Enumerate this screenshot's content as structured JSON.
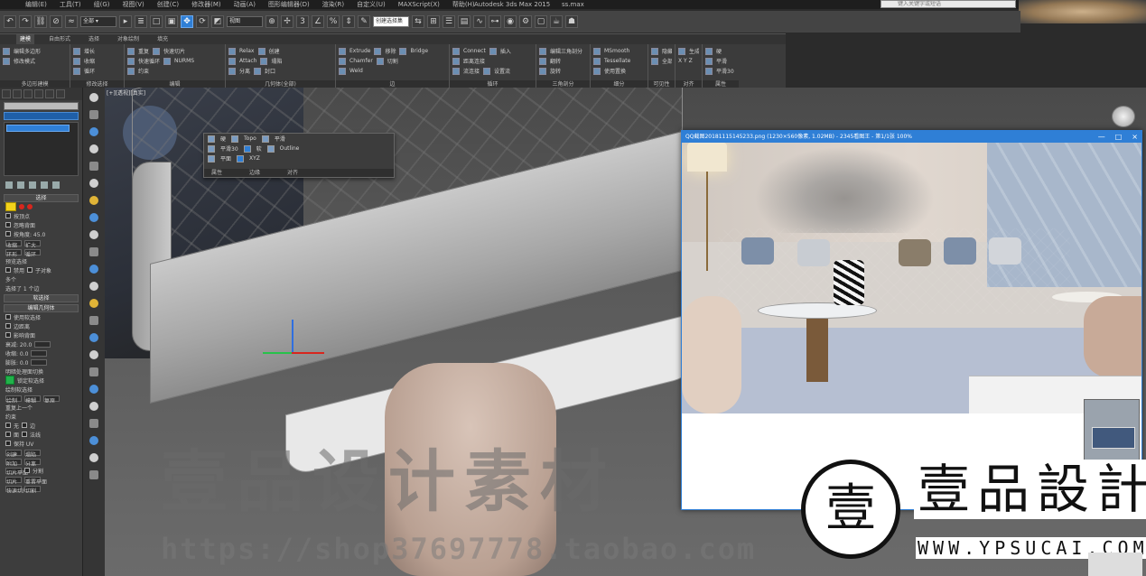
{
  "window": {
    "app_title": "Autodesk 3ds Max 2015",
    "file_title": "ss.max",
    "search_placeholder": "键入关键字或短语"
  },
  "menu": {
    "items": [
      "编辑(E)",
      "工具(T)",
      "组(G)",
      "视图(V)",
      "创建(C)",
      "修改器(M)",
      "动画(A)",
      "图形编辑器(D)",
      "渲染(R)",
      "自定义(U)",
      "MAXScript(X)",
      "帮助(H)"
    ]
  },
  "toolbar": {
    "view_select": "视图",
    "selection_set": "创建选择集"
  },
  "ribbon": {
    "tabs": [
      "建模",
      "自由形式",
      "选择",
      "对象绘制",
      "填充"
    ],
    "groups": [
      {
        "label": "多边形建模",
        "rows": [
          "编辑多边形",
          "修改模式"
        ]
      },
      {
        "label": "修改选择",
        "rows": [
          "增长",
          "收缩",
          "循环",
          "环形"
        ]
      },
      {
        "label": "编辑",
        "rows": [
          "重复",
          "快速切片",
          "快速循环",
          "NURMS",
          "约束"
        ]
      },
      {
        "label": "几何体(全部)",
        "rows": [
          "Relax",
          "创建",
          "Attach",
          "塌陷",
          "分离",
          "封口"
        ]
      },
      {
        "label": "边",
        "rows": [
          "Extrude",
          "移除",
          "Bridge",
          "Chamfer",
          "切割",
          "Weld"
        ]
      },
      {
        "label": "循环",
        "rows": [
          "Connect",
          "插入",
          "距离连接",
          "流连接",
          "设置流"
        ]
      },
      {
        "label": "三角剖分",
        "rows": [
          "编辑三角剖分",
          "翻转",
          "旋转"
        ]
      },
      {
        "label": "细分",
        "rows": [
          "MSmooth",
          "Tessellate",
          "使用置换"
        ]
      },
      {
        "label": "可见性",
        "rows": [
          "隐藏选定对象",
          "全部取消隐藏"
        ]
      },
      {
        "label": "对齐",
        "rows": [
          "生成平面",
          "X Y Z"
        ]
      },
      {
        "label": "属性",
        "rows": [
          "硬",
          "平滑",
          "平滑30"
        ]
      }
    ]
  },
  "left_panel": {
    "rollouts": [
      "选择",
      "软选择",
      "编辑几何体"
    ],
    "rows": [
      "按顶点",
      "忽略背面",
      "按角度: 45.0",
      "收缩",
      "扩大",
      "环形",
      "循环",
      "预览选择",
      "禁用",
      "子对象",
      "多个",
      "选择了 1 个边",
      "使用软选择",
      "边距离",
      "影响背面",
      "衰减: 20.0",
      "收缩: 0.0",
      "膨胀: 0.0",
      "明暗处理面切换",
      "锁定软选择",
      "绘制软选择",
      "绘制",
      "模糊",
      "复原",
      "重复上一个",
      "约束",
      "无",
      "边",
      "面",
      "法线",
      "保持 UV",
      "创建",
      "塌陷",
      "附加",
      "分离",
      "切片平面",
      "分割",
      "切片",
      "重置平面",
      "快速切片",
      "切割"
    ]
  },
  "viewport": {
    "label": "[+][透视][真实]"
  },
  "float_panel": {
    "row1": [
      "硬",
      "Topo",
      "平滑"
    ],
    "row2": [
      "平滑30",
      "软",
      "Outline"
    ],
    "row3": [
      "平面",
      "XYZ"
    ],
    "bottom": [
      "属性",
      "边缘",
      "对齐"
    ]
  },
  "viewer": {
    "title": "QQ截图20181115145233.png (1230×560像素, 1.02MB) - 2345看图王 - 第1/1张 100%",
    "controls": [
      "—",
      "□",
      "×"
    ]
  },
  "watermark": {
    "cn": "壹品设计素材",
    "url": "https://shop37697778.taobao.com"
  },
  "logo": {
    "glyph": "壹",
    "text": "壹品設計",
    "url": "WWW.YPSUCAI.COM"
  }
}
